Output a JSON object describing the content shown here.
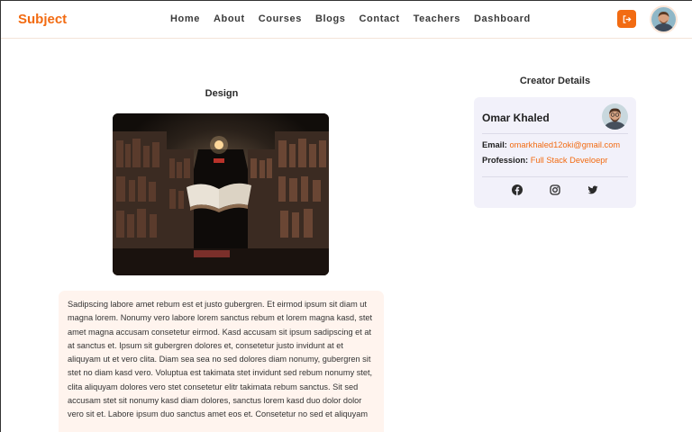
{
  "header": {
    "logo": "Subject",
    "nav": [
      "Home",
      "About",
      "Courses",
      "Blogs",
      "Contact",
      "Teachers",
      "Dashboard"
    ],
    "logout_icon": "logout-icon",
    "accent_color": "#f26b12"
  },
  "post": {
    "title": "Design",
    "image_icon": "library-book-image",
    "body": "Sadipscing labore amet rebum est et justo gubergren. Et eirmod ipsum sit diam ut magna lorem. Nonumy vero labore lorem sanctus rebum et lorem magna kasd, stet amet magna accusam consetetur eirmod. Kasd accusam sit ipsum sadipscing et at at sanctus et. Ipsum sit gubergren dolores et, consetetur justo invidunt at et aliquyam ut et vero clita. Diam sea sea no sed dolores diam nonumy, gubergren sit stet no diam kasd vero. Voluptua est takimata stet invidunt sed rebum nonumy stet, clita aliquyam dolores vero stet consetetur elitr takimata rebum sanctus. Sit sed accusam stet sit nonumy kasd diam dolores, sanctus lorem kasd duo dolor dolor vero sit et. Labore ipsum duo sanctus amet eos et. Consetetur no sed et aliquyam"
  },
  "creator": {
    "heading": "Creator Details",
    "name": "Omar Khaled",
    "email_label": "Email:",
    "email": "omarkhaled12oki@gmail.com",
    "profession_label": "Profession:",
    "profession": "Full Stack Develoepr",
    "socials": [
      "facebook-icon",
      "instagram-icon",
      "twitter-icon"
    ]
  }
}
